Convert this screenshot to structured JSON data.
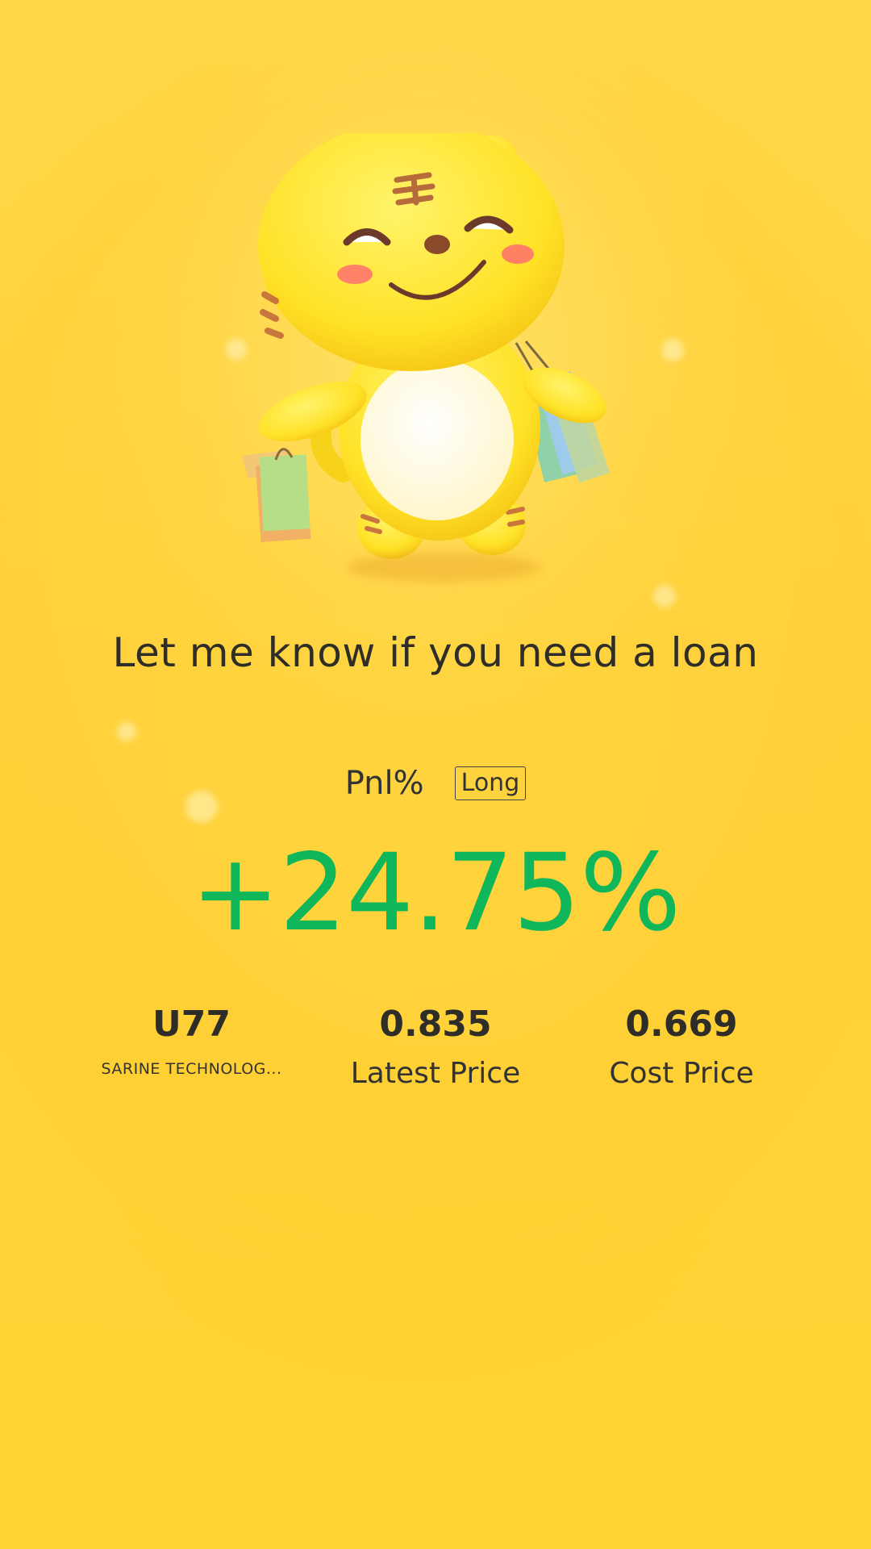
{
  "mascot": {
    "icon": "tiger-mascot-icon"
  },
  "headline": "Let me know if you need a loan",
  "pnl": {
    "label": "Pnl%",
    "direction_badge": "Long",
    "value": "+24.75%",
    "value_color": "#10B65A"
  },
  "stats": [
    {
      "value": "U77",
      "label": "SARINE TECHNOLOG..."
    },
    {
      "value": "0.835",
      "label": "Latest Price"
    },
    {
      "value": "0.669",
      "label": "Cost Price"
    }
  ],
  "colors": {
    "background": "#FFD23A",
    "text": "#2f2d28",
    "positive": "#10B65A"
  }
}
